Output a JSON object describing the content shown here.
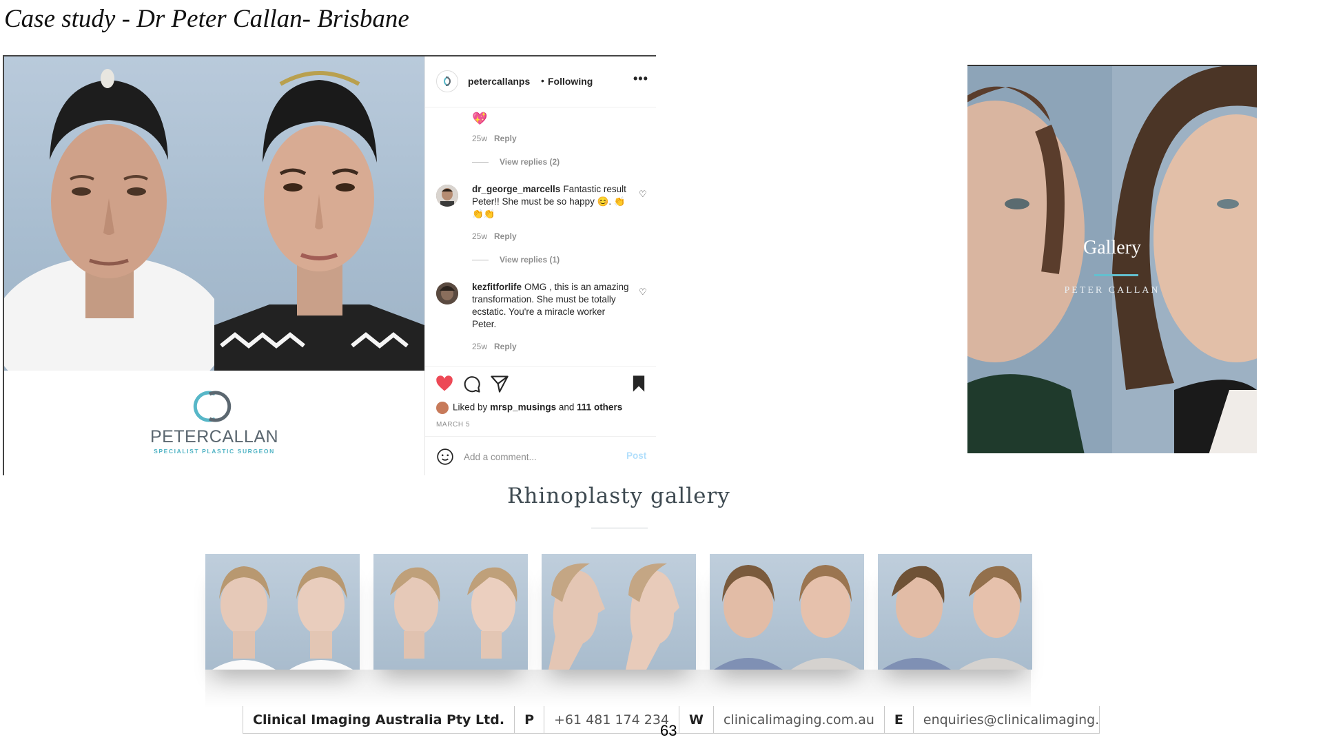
{
  "slide": {
    "title": "Case study - Dr Peter Callan- Brisbane",
    "page_number": "63"
  },
  "instagram_post": {
    "brand": {
      "name": "PETERCALLAN",
      "subtitle": "SPECIALIST PLASTIC SURGEON"
    },
    "header": {
      "username": "petercallanps",
      "separator": "•",
      "follow_status": "Following",
      "more_label": "•••"
    },
    "comments": [
      {
        "emoji": "💖",
        "age": "25w",
        "reply_label": "Reply",
        "view_replies": "View replies (2)"
      },
      {
        "username": "dr_george_marcells",
        "text": "Fantastic result Peter!! She must be so happy 😊. 👏👏👏",
        "age": "25w",
        "reply_label": "Reply",
        "view_replies": "View replies (1)"
      },
      {
        "username": "kezfitforlife",
        "text": "OMG , this is an amazing transformation. She must be totally ecstatic. You're a miracle worker Peter.",
        "age": "25w",
        "reply_label": "Reply"
      }
    ],
    "actions": {
      "liked_prefix": "Liked by",
      "liked_user": "mrsp_musings",
      "liked_and": "and",
      "liked_others": "111 others",
      "date": "MARCH 5",
      "comment_placeholder": "Add a comment...",
      "post_label": "Post"
    },
    "colors": {
      "heart": "#ed4956",
      "post_disabled": "#b2dffc",
      "meta": "#8e8e8e"
    }
  },
  "gallery_hero": {
    "title": "Gallery",
    "subtitle": "PETER CALLAN",
    "accent_color": "#62c0cf"
  },
  "rhinoplasty": {
    "title": "Rhinoplasty gallery",
    "thumbnails": [
      {
        "patient": "patient-1",
        "view": "front"
      },
      {
        "patient": "patient-1",
        "view": "oblique"
      },
      {
        "patient": "patient-1",
        "view": "profile"
      },
      {
        "patient": "patient-2",
        "view": "front"
      },
      {
        "patient": "patient-2",
        "view": "oblique"
      }
    ]
  },
  "footer": {
    "company": "Clinical Imaging Australia Pty Ltd.",
    "phone_key": "P",
    "phone": "+61 481 174 234",
    "web_key": "W",
    "web": "clinicalimaging.com.au",
    "email_key": "E",
    "email": "enquiries@clinicalimaging.com.au"
  }
}
